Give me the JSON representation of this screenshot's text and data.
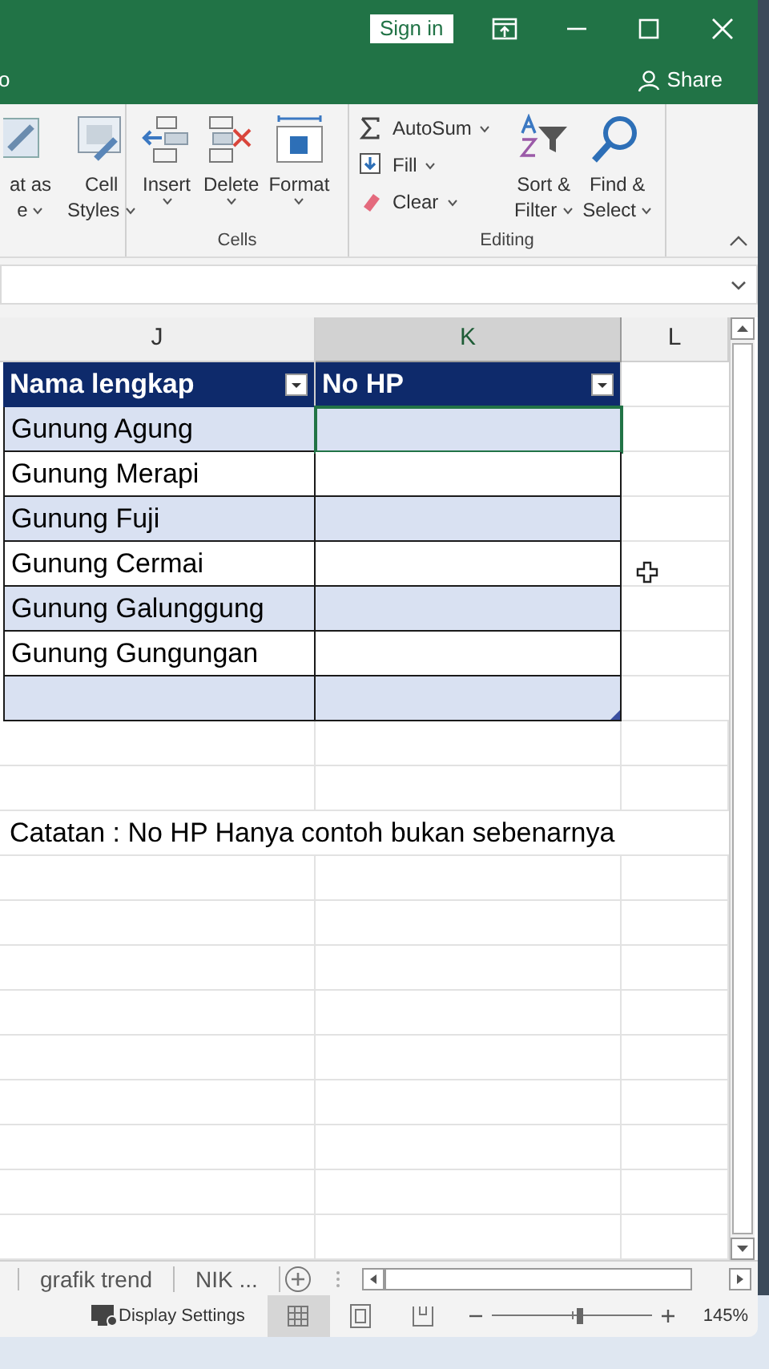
{
  "title_bar": {
    "sign_in": "Sign in"
  },
  "ribbon_tabs": {
    "partial_tab": "o",
    "share": "Share"
  },
  "ribbon": {
    "groups": [
      {
        "commands": [
          {
            "kind": "large",
            "lines": [
              "at as",
              "e"
            ]
          },
          {
            "kind": "large",
            "lines": [
              "Cell",
              "Styles"
            ]
          }
        ]
      },
      {
        "label": "Cells",
        "commands": [
          {
            "kind": "large",
            "lines": [
              "Insert"
            ]
          },
          {
            "kind": "large",
            "lines": [
              "Delete"
            ]
          },
          {
            "kind": "large",
            "lines": [
              "Format"
            ]
          }
        ]
      },
      {
        "label": "Editing",
        "commands": [
          {
            "kind": "small",
            "lines": [
              "AutoSum"
            ]
          },
          {
            "kind": "small",
            "lines": [
              "Fill"
            ]
          },
          {
            "kind": "small",
            "lines": [
              "Clear"
            ]
          },
          {
            "kind": "large",
            "lines": [
              "Sort &",
              "Filter"
            ]
          },
          {
            "kind": "large",
            "lines": [
              "Find &",
              "Select"
            ]
          }
        ]
      }
    ]
  },
  "columns": [
    {
      "label": "J",
      "selected": false
    },
    {
      "label": "K",
      "selected": true
    },
    {
      "label": "L",
      "selected": false
    }
  ],
  "table": {
    "headers": [
      "Nama lengkap",
      "No HP"
    ],
    "rows": [
      {
        "name": "Gunung Agung",
        "selected": true
      },
      {
        "name": "Gunung Merapi",
        "selected": false
      },
      {
        "name": "Gunung Fuji",
        "selected": false
      },
      {
        "name": "Gunung Cermai",
        "selected": false
      },
      {
        "name": "Gunung Galunggung",
        "selected": false
      },
      {
        "name": "Gunung Gungungan",
        "selected": false
      }
    ]
  },
  "note": "Catatan : No HP Hanya contoh bukan sebenarnya",
  "sheet_tabs": [
    {
      "label": "grafik trend",
      "selected": false
    },
    {
      "label": "NIK ...",
      "selected": false
    }
  ],
  "status_bar": {
    "display_settings": "Display Settings",
    "views": [
      {
        "selected": true
      },
      {
        "selected": false
      },
      {
        "selected": false
      }
    ],
    "zoom": {
      "level": 0.55
    },
    "zoom_reading": "145%"
  }
}
